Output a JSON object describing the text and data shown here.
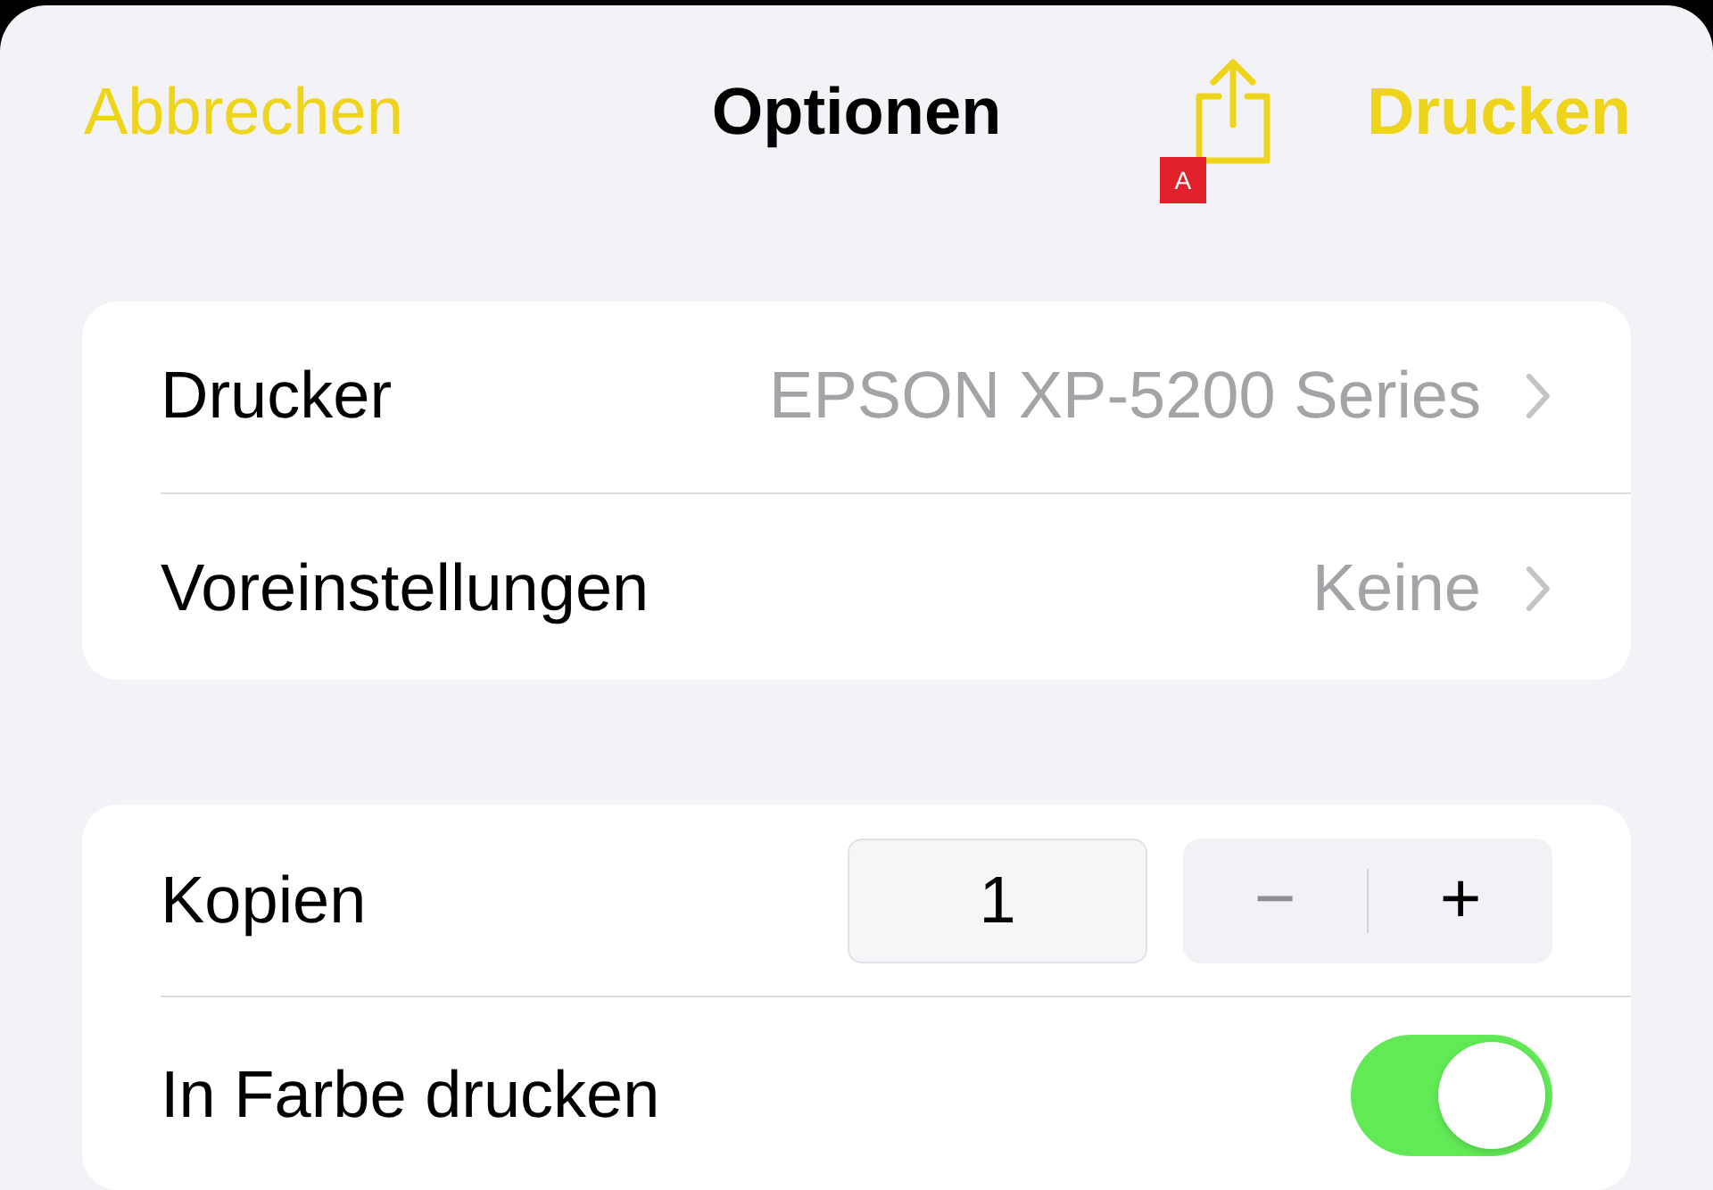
{
  "header": {
    "cancel": "Abbrechen",
    "title": "Optionen",
    "print": "Drucken",
    "badge": "A"
  },
  "printer_section": [
    {
      "label": "Drucker",
      "value": "EPSON XP-5200 Series"
    },
    {
      "label": "Voreinstellungen",
      "value": "Keine"
    }
  ],
  "options_section": [
    {
      "kind": "stepper",
      "label": "Kopien",
      "value": "1",
      "minus": "−",
      "plus": "+"
    },
    {
      "kind": "toggle",
      "label": "In Farbe drucken",
      "on": true
    }
  ]
}
